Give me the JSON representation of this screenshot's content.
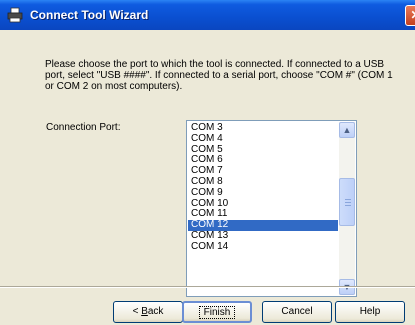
{
  "window": {
    "title": "Connect Tool Wizard",
    "close_glyph": "✕"
  },
  "instructions": "Please choose the port to which the tool is connected.  If connected to a USB port, select \"USB ####\".  If connected to a serial port, choose \"COM #\" (COM 1 or COM 2 on most computers).",
  "port_label": "Connection Port:",
  "ports": [
    "COM 3",
    "COM 4",
    "COM 5",
    "COM 6",
    "COM 7",
    "COM 8",
    "COM 9",
    "COM 10",
    "COM 11",
    "COM 12",
    "COM 13",
    "COM 14"
  ],
  "selected_port": "COM 12",
  "buttons": {
    "back_prefix": "< ",
    "back_accel": "B",
    "back_rest": "ack",
    "finish": "Finish",
    "cancel": "Cancel",
    "help": "Help"
  },
  "colors": {
    "title_bar": "#0a4fd0",
    "selection": "#316ac5",
    "dialog_bg": "#ece9d8"
  }
}
